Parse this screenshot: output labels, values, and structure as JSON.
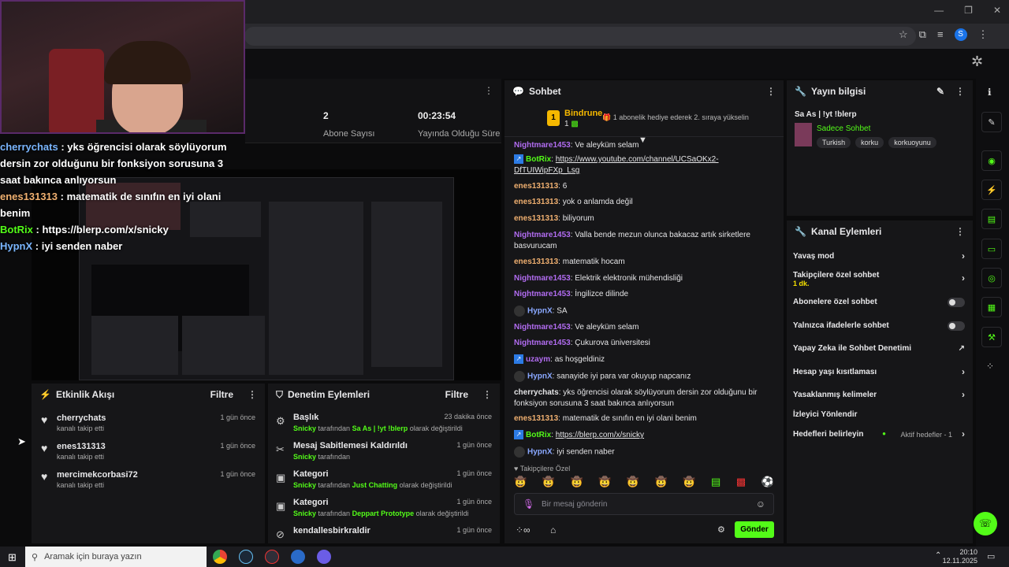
{
  "stats": [
    {
      "value": "2",
      "label": "Abone Sayısı"
    },
    {
      "value": "00:23:54",
      "label": "Yayında Olduğu Süre"
    }
  ],
  "overlay_chat": [
    {
      "user": "cherrychats",
      "text": "yks öğrencisi olarak söylüyorum dersin zor olduğunu bir fonksiyon sorusuna 3 saat bakınca anlıyorsun",
      "color": "#7ab6ff"
    },
    {
      "user": "enes131313",
      "text": "matematik de sınıfın en iyi olani benim",
      "color": "#f0b070"
    },
    {
      "user": "BotRix",
      "text": "https://blerp.com/x/snicky",
      "color": "#53fc18"
    },
    {
      "user": "HypnX",
      "text": "iyi senden naber",
      "color": "#7ab6ff"
    }
  ],
  "activity": {
    "title": "Etkinlik Akışı",
    "filter": "Filtre",
    "items": [
      {
        "name": "cherrychats",
        "sub": "kanalı takip etti",
        "time": "1 gün önce"
      },
      {
        "name": "enes131313",
        "sub": "kanalı takip etti",
        "time": "1 gün önce"
      },
      {
        "name": "mercimekcorbasi72",
        "sub": "kanalı takip etti",
        "time": "1 gün önce"
      }
    ]
  },
  "mod": {
    "title": "Denetim Eylemleri",
    "filter": "Filtre",
    "items": [
      {
        "title": "Başlık",
        "actor": "Snicky",
        "mid": " tarafından ",
        "target": "Sa As | !yt !blerp",
        "tail": " olarak değiştirildi",
        "time": "23 dakika önce",
        "icon": "⚙"
      },
      {
        "title": "Mesaj Sabitlemesi Kaldırıldı",
        "actor": "Snicky",
        "mid": " tarafından",
        "target": "",
        "tail": "",
        "time": "1 gün önce",
        "icon": "✂"
      },
      {
        "title": "Kategori",
        "actor": "Snicky",
        "mid": " tarafından ",
        "target": "Just Chatting",
        "tail": " olarak değiştirildi",
        "time": "1 gün önce",
        "icon": "▣"
      },
      {
        "title": "Kategori",
        "actor": "Snicky",
        "mid": " tarafından ",
        "target": "Deppart Prototype",
        "tail": " olarak değiştirildi",
        "time": "1 gün önce",
        "icon": "▣"
      },
      {
        "title": "kendallesbirkraldir",
        "actor": "",
        "mid": "",
        "target": "",
        "tail": "",
        "time": "1 gün önce",
        "icon": "⊘"
      }
    ]
  },
  "chat": {
    "title": "Sohbet",
    "pinned_user": "Bindrune",
    "pinned_count": "1",
    "pinned_rank": "1",
    "pinned_text": "1 abonelik hediye ederek 2. sıraya yükselin",
    "messages": [
      {
        "user": "Nightmare1453",
        "cls": "u-p",
        "text": "Ve aleyküm selam"
      },
      {
        "user": "BotRix",
        "cls": "u-g",
        "text": "https://www.youtube.com/channel/UCSaOKx2-DfTUIWipFXp_Lsg",
        "bot": true,
        "link": true
      },
      {
        "user": "enes131313",
        "cls": "u-o",
        "text": "6"
      },
      {
        "user": "enes131313",
        "cls": "u-o",
        "text": "yok o anlamda değil"
      },
      {
        "user": "enes131313",
        "cls": "u-o",
        "text": "biliyorum"
      },
      {
        "user": "Nightmare1453",
        "cls": "u-p",
        "text": "Valla bende mezun olunca bakacaz artık sirketlere basvurucam"
      },
      {
        "user": "enes131313",
        "cls": "u-o",
        "text": "matematik hocam"
      },
      {
        "user": "Nightmare1453",
        "cls": "u-p",
        "text": "Elektrik elektronik mühendisliği"
      },
      {
        "user": "Nightmare1453",
        "cls": "u-p",
        "text": "İngilizce dilinde"
      },
      {
        "user": "HypnX",
        "cls": "u-n",
        "text": "SA",
        "avatar": true
      },
      {
        "user": "Nightmare1453",
        "cls": "u-p",
        "text": "Ve aleyküm selam"
      },
      {
        "user": "Nightmare1453",
        "cls": "u-p",
        "text": "Çukurova üniversitesi"
      },
      {
        "user": "uzaym",
        "cls": "u-p",
        "text": "as hoşgeldiniz",
        "bot": true
      },
      {
        "user": "HypnX",
        "cls": "u-n",
        "text": "sanayide iyi para var okuyup napcanız",
        "avatar": true
      },
      {
        "user": "cherrychats",
        "cls": "u-w",
        "text": "yks öğrencisi olarak söylüyorum dersin zor olduğunu bir fonksiyon sorusuna 3 saat bakınca anlıyorsun"
      },
      {
        "user": "enes131313",
        "cls": "u-o",
        "text": "matematik de sınıfın en iyi olani benim"
      },
      {
        "user": "BotRix",
        "cls": "u-g",
        "text": "https://blerp.com/x/snicky",
        "bot": true,
        "link": true
      },
      {
        "user": "HypnX",
        "cls": "u-n",
        "text": "iyi senden naber",
        "avatar": true
      }
    ],
    "followers_label": "Takipçilere Özel",
    "input_placeholder": "Bir mesaj gönderin",
    "send_label": "Gönder"
  },
  "stream_info": {
    "title": "Yayın bilgisi",
    "stream_title": "Sa As | !yt !blerp",
    "category": "Sadece Sohbet",
    "tags": [
      "Turkish",
      "korku",
      "korkuoyunu"
    ]
  },
  "channel_actions": {
    "title": "Kanal Eylemleri",
    "items": [
      {
        "label": "Yavaş mod",
        "kind": "chev"
      },
      {
        "label": "Takipçilere özel sohbet",
        "sub": "1 dk.",
        "kind": "chev"
      },
      {
        "label": "Abonelere özel sohbet",
        "kind": "toggle"
      },
      {
        "label": "Yalnızca ifadelerle sohbet",
        "kind": "toggle"
      },
      {
        "label": "Yapay Zeka ile Sohbet Denetimi",
        "kind": "ext"
      },
      {
        "label": "Hesap yaşı kısıtlaması",
        "kind": "chev"
      },
      {
        "label": "Yasaklanmış kelimeler",
        "kind": "chev"
      },
      {
        "label": "İzleyici Yönlendir",
        "kind": "none"
      },
      {
        "label": "Hedefleri belirleyin",
        "extra": "Aktif hedefler - 1",
        "kind": "chev"
      }
    ]
  },
  "taskbar": {
    "search_placeholder": "Aramak için buraya yazın",
    "time": "20:10",
    "date": "12.11.2025"
  },
  "colors": {
    "accent": "#53fc18",
    "panel": "#161618",
    "background": "#0b0b0c"
  }
}
